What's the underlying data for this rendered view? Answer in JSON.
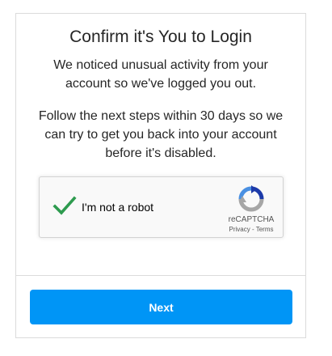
{
  "dialog": {
    "title": "Confirm it's You to Login",
    "message_1_line_1": "We noticed unusual activity from your",
    "message_1_line_2": "account so we've logged you out.",
    "message_2_line_1": "Follow the next steps within 30 days so we",
    "message_2_line_2": "can try to get you back into your account",
    "message_2_line_3": "before it's disabled."
  },
  "captcha": {
    "label": "I'm not a robot",
    "checked": true,
    "brand": "reCAPTCHA",
    "privacy_link": "Privacy",
    "separator": " - ",
    "terms_link": "Terms",
    "check_color": "#2e9b4f",
    "logo_icon": "recaptcha-logo-icon"
  },
  "actions": {
    "next_label": "Next",
    "next_color": "#0095f6"
  }
}
